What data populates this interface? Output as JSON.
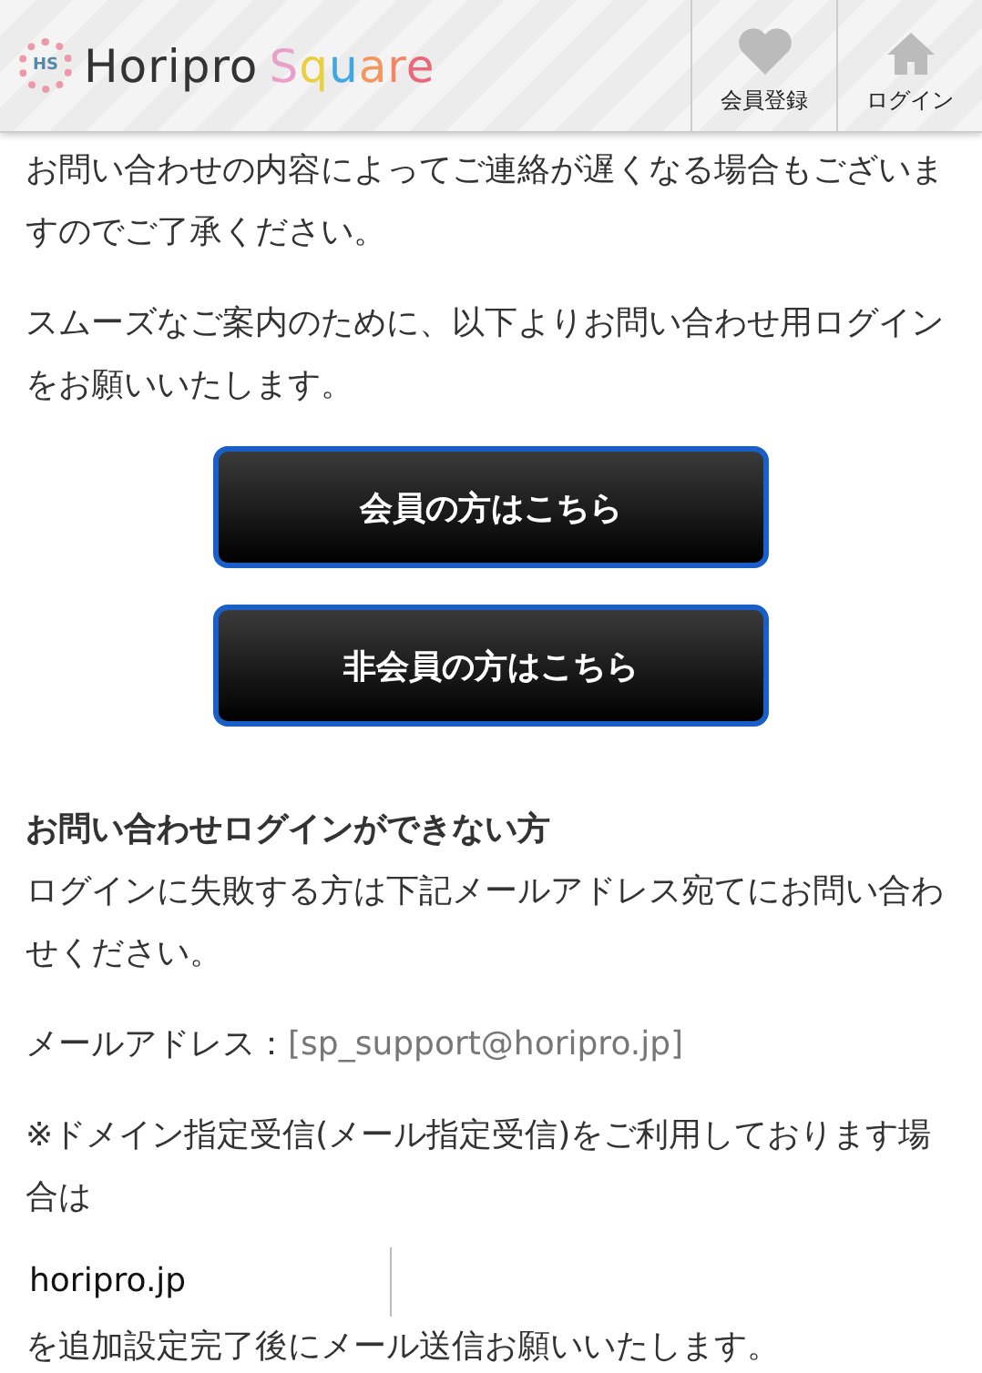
{
  "header": {
    "logo_badge": "HS",
    "logo_text": "Horipro",
    "logo_accent": "Square",
    "nav": [
      {
        "label": "会員登録",
        "kind": "heart"
      },
      {
        "label": "ログイン",
        "kind": "home"
      }
    ]
  },
  "intro": [
    "お問い合わせの内容によってご連絡が遅くなる場合もございますのでご了承ください。",
    "スムーズなご案内のために、以下よりお問い合わせ用ログインをお願いいたします。"
  ],
  "buttons": [
    "会員の方はこちら",
    "非会員の方はこちら"
  ],
  "help": {
    "heading": "お問い合わせログインができない方",
    "text": "ログインに失敗する方は下記メールアドレス宛てにお問い合わせください。",
    "email_label": "メールアドレス：",
    "email": "[sp_support@horipro.jp]",
    "note": "※ドメイン指定受信(メール指定受信)をご利用しております場合は",
    "domain": "horipro.jp",
    "after": "を追加設定完了後にメール送信お願いいたします。"
  }
}
